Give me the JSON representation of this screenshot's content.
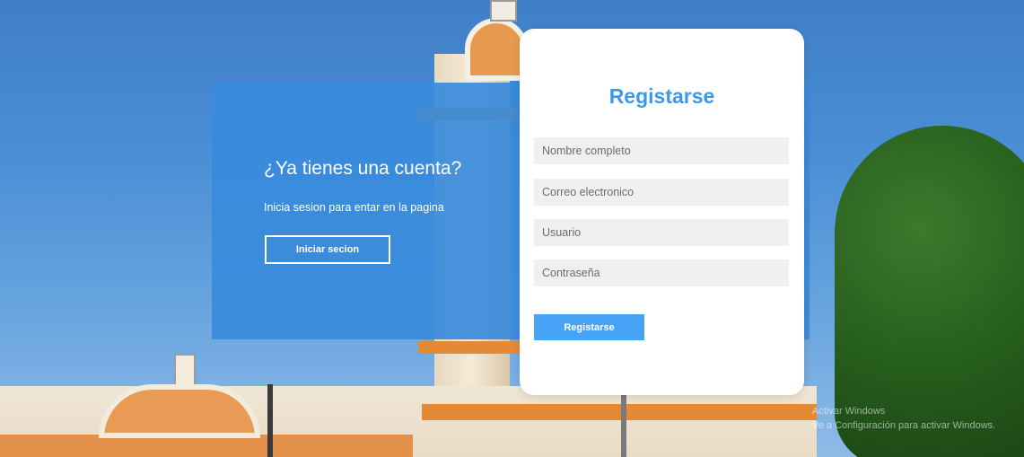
{
  "info": {
    "title": "¿Ya tienes una cuenta?",
    "text": "Inicia sesion para entar en la pagina",
    "login_label": "Iniciar secion"
  },
  "form": {
    "title": "Registarse",
    "fields": {
      "full_name": {
        "placeholder": "Nombre completo",
        "value": ""
      },
      "email": {
        "placeholder": "Correo electronico",
        "value": ""
      },
      "username": {
        "placeholder": "Usuario",
        "value": ""
      },
      "password": {
        "placeholder": "Contraseña",
        "value": ""
      }
    },
    "submit_label": "Registarse"
  },
  "watermark": {
    "line1": "Activar Windows",
    "line2": "Ve a Configuración para activar Windows."
  },
  "colors": {
    "panel_blue": "#3a8bdc",
    "title_blue": "#3d98ea",
    "button_blue": "#46a3f5",
    "card_white": "#ffffff",
    "field_gray": "#f0f0f0"
  }
}
